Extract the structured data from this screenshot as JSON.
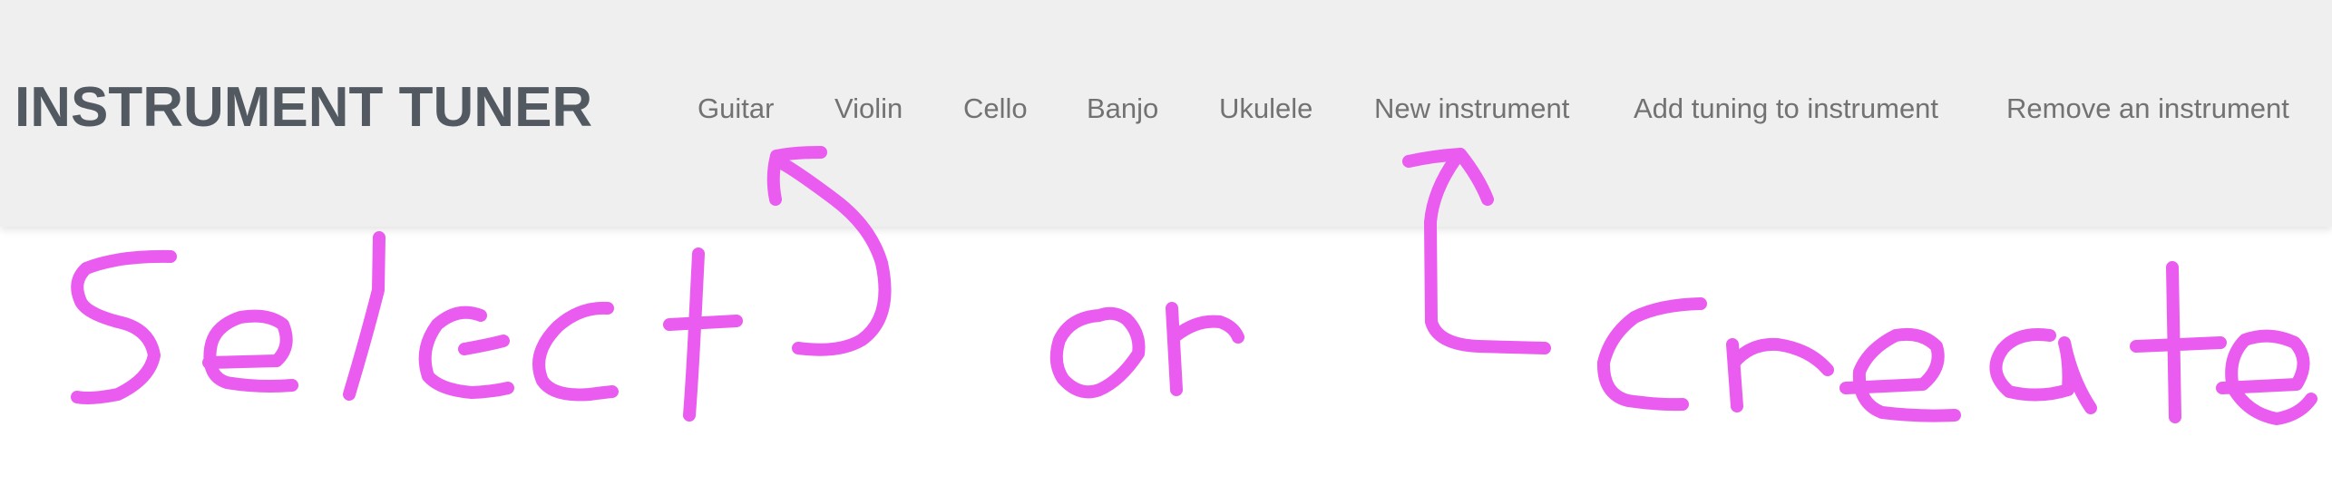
{
  "app": {
    "brand": "INSTRUMENT TUNER"
  },
  "nav": {
    "items": [
      {
        "label": "Guitar"
      },
      {
        "label": "Violin"
      },
      {
        "label": "Cello"
      },
      {
        "label": "Banjo"
      },
      {
        "label": "Ukulele"
      },
      {
        "label": "New instrument"
      },
      {
        "label": "Add tuning to instrument"
      },
      {
        "label": "Remove an instrument"
      }
    ]
  },
  "annotation": {
    "words": [
      "Select",
      "or",
      "Create"
    ],
    "color": "#ea5bf0"
  },
  "colors": {
    "navbar_bg": "#efefef",
    "brand_text": "#535961",
    "link_text": "#727272"
  }
}
